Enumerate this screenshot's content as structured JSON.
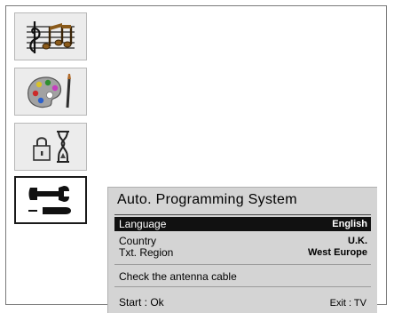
{
  "sidebar": {
    "items": [
      {
        "icon": "music-notes-icon",
        "selected": false
      },
      {
        "icon": "paint-palette-icon",
        "selected": false
      },
      {
        "icon": "lock-timer-icon",
        "selected": false
      },
      {
        "icon": "wrench-screwdriver-icon",
        "selected": true
      }
    ]
  },
  "dialog": {
    "title": "Auto. Programming System",
    "rows": [
      {
        "label": "Language",
        "value": "English",
        "highlighted": true
      },
      {
        "label": "Country",
        "value": "U.K.",
        "highlighted": false
      },
      {
        "label": "Txt. Region",
        "value": "West Europe",
        "highlighted": false
      }
    ],
    "message": "Check the antenna cable",
    "footer": {
      "start": "Start : Ok",
      "exit": "Exit : TV"
    }
  },
  "colors": {
    "highlight": "#111111",
    "panel_bg": "#d4d4d4",
    "tab_bg": "#ececec"
  }
}
